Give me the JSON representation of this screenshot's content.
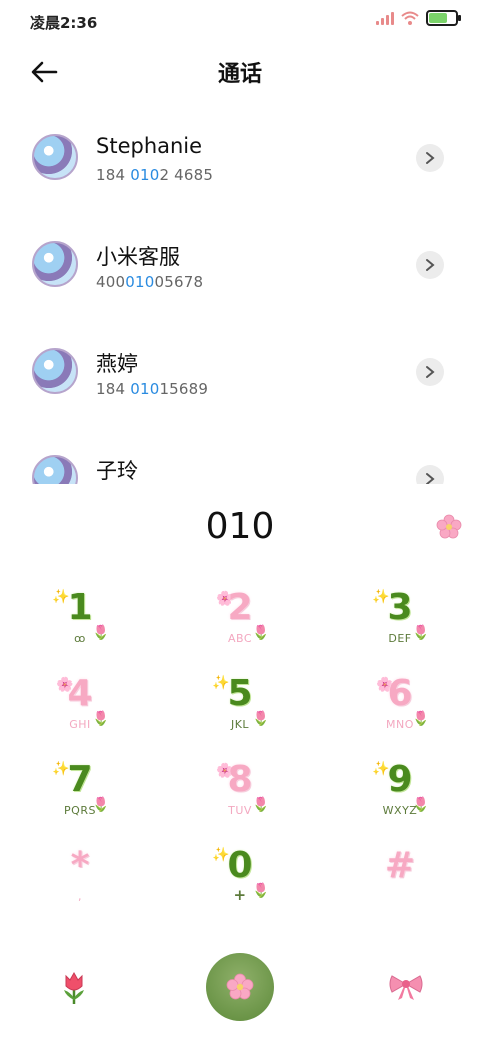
{
  "status_bar": {
    "time": "凌晨2:36"
  },
  "header": {
    "title": "通话"
  },
  "contacts": [
    {
      "name": "Stephanie",
      "number_pre": "184 ",
      "number_hl": "010",
      "number_post": "2 4685"
    },
    {
      "name": "小米客服",
      "number_pre": "400",
      "number_hl": "010",
      "number_post": "05678"
    },
    {
      "name": "燕婷",
      "number_pre": "184 ",
      "number_hl": "010",
      "number_post": "15689"
    },
    {
      "name": "子玲",
      "number_pre": "",
      "number_hl": "",
      "number_post": ""
    }
  ],
  "dial": {
    "number": "010"
  },
  "keys": [
    {
      "digit": "1",
      "letters": "ꝏ"
    },
    {
      "digit": "2",
      "letters": "ABC"
    },
    {
      "digit": "3",
      "letters": "DEF"
    },
    {
      "digit": "4",
      "letters": "GHI"
    },
    {
      "digit": "5",
      "letters": "JKL"
    },
    {
      "digit": "6",
      "letters": "MNO"
    },
    {
      "digit": "7",
      "letters": "PQRS"
    },
    {
      "digit": "8",
      "letters": "TUV"
    },
    {
      "digit": "9",
      "letters": "WXYZ"
    },
    {
      "digit": "*",
      "letters": ","
    },
    {
      "digit": "0",
      "letters": "+"
    },
    {
      "digit": "#",
      "letters": ""
    }
  ],
  "colors": {
    "highlight": "#2a8be0",
    "green_key": "#4a8a1e",
    "pink_key": "#f7a9c3",
    "call_button": "#5d8a3a"
  },
  "icons": {
    "back": "arrow-left-icon",
    "contact_arrow": "chevron-right-icon",
    "call": "flower-icon",
    "left_action": "tulip-icon",
    "right_action": "bow-icon"
  }
}
